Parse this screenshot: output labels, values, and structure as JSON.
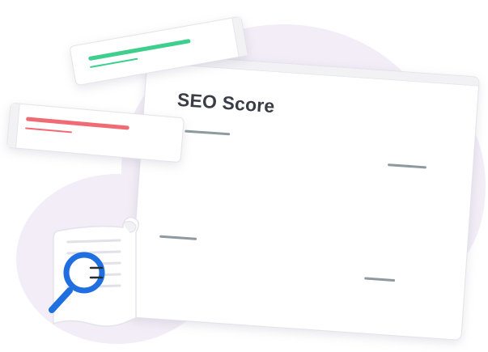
{
  "main_card": {
    "title": "SEO Score"
  },
  "score_bars": {
    "good": {
      "color": "#3ecf8e"
    },
    "bad": {
      "color": "#f06b73"
    }
  },
  "colors": {
    "magnifier": "#1f6fe0",
    "background_blob": "#f3edf7",
    "placeholder_line": "#8e9aa0"
  },
  "icons": {
    "document": "document-icon",
    "magnifier": "magnifier-icon"
  }
}
